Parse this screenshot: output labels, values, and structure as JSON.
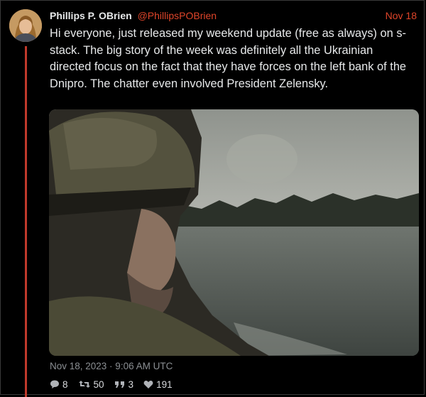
{
  "tweet": {
    "author_name": "Phillips P. OBrien",
    "author_handle": "@PhillipsPOBrien",
    "date_short": "Nov 18",
    "text": "Hi everyone, just released my weekend update (free as always) on s-stack. The big story of the week was definitely all the Ukrainian directed focus on the fact that they have forces on the left bank of the Dnipro. The chatter even involved President Zelensky.",
    "timestamp": "Nov 18, 2023 · 9:06 AM UTC",
    "stats": {
      "replies": "8",
      "retweets": "50",
      "quotes": "3",
      "likes": "191"
    }
  },
  "colors": {
    "accent": "#e0452a",
    "thread_line": "#c0392b",
    "background": "#000000"
  },
  "icons": [
    "comment-icon",
    "retweet-icon",
    "quote-icon",
    "heart-icon"
  ]
}
